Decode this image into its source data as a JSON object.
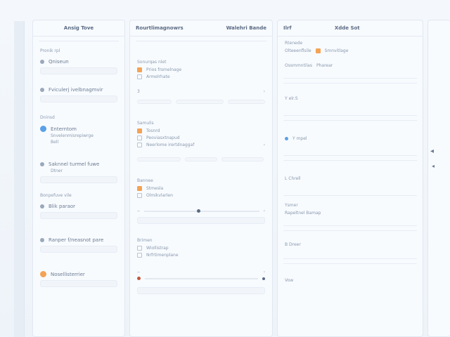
{
  "col1": {
    "title": "Ansig Tove",
    "section1": "Pronik rpl",
    "item1": "Qniseun",
    "item2": "Fviculerj ivelbnagmvir",
    "section2": "Dninsd",
    "item3_title": "Enterntom",
    "item3_sub": "Snvelenmisrepiwrge",
    "item3_tag": "Bell",
    "item4_title": "Saknnel turmel fuwe",
    "item4_sub": "Dtner",
    "section3": "Bonpefuve vile",
    "item5": "Blik paraor",
    "item6": "Ranper f/neasnot pare",
    "item7": "Nosellisterrier"
  },
  "col2": {
    "title": "Rourtlimagnowrs",
    "right": "Walehri Bande",
    "group1": "Sonurqas nlet",
    "g1_opt1": "Prios frsmelnage",
    "g1_opt2": "Armelrhate",
    "g1_num": "3",
    "group2": "Samulis",
    "g2_opt1": "Tosnrd",
    "g2_opt2": "Peoviasxtnapud",
    "g2_opt3": "Neerlome irertdnaggaf",
    "group3": "Bannee",
    "g3_opt1": "Stmesla",
    "g3_opt2": "Olmikvlarlen",
    "group4": "Brimen",
    "g4_opt1": "Wiollistrap",
    "g4_opt2": "Nrfrtimenplane"
  },
  "col3": {
    "left": "Ilrf",
    "title": "Xdde Sot",
    "sub": "Rtenede",
    "tag1": "Olteeenflsile",
    "tag2": "Smnvitlage",
    "tag3": "Ossmmntilas",
    "tag4": "Pharear",
    "r1": "Y elr.S",
    "r2": "Y mpel",
    "r3": "L Chrell",
    "sec": "Ysmer",
    "r4": "Rapeltnel Bamap",
    "r5": "B Dreer",
    "r6": "Vow"
  }
}
